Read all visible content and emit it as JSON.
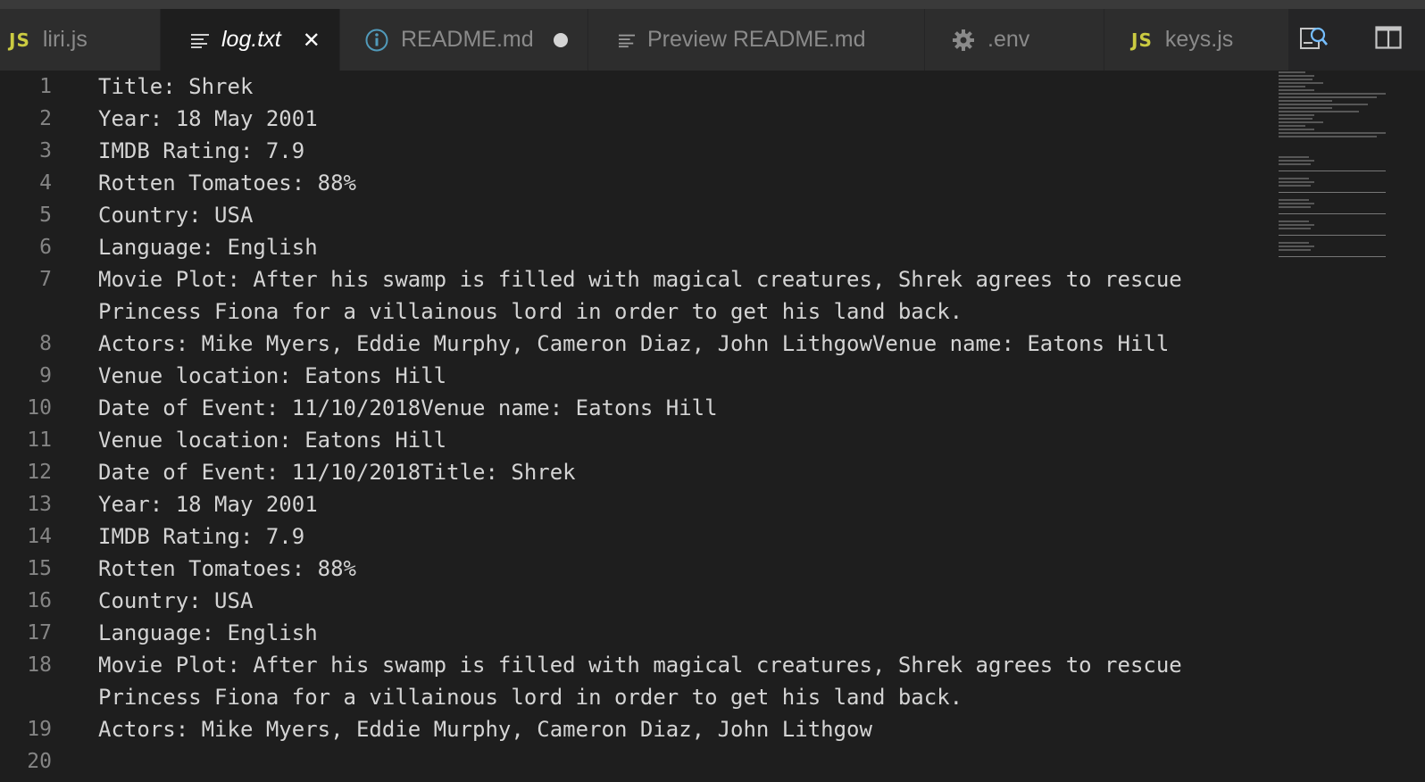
{
  "tabs": [
    {
      "label": "liri.js",
      "icon": "js-icon",
      "state": "normal"
    },
    {
      "label": "log.txt",
      "icon": "text-file-icon",
      "state": "active"
    },
    {
      "label": "README.md",
      "icon": "info-icon",
      "state": "dirty"
    },
    {
      "label": "Preview README.md",
      "icon": "text-file-icon",
      "state": "normal"
    },
    {
      "label": ".env",
      "icon": "gear-icon",
      "state": "normal"
    },
    {
      "label": "keys.js",
      "icon": "js-icon",
      "state": "normal"
    }
  ],
  "icon_text": {
    "js": "JS"
  },
  "close_glyph": "✕",
  "colors": {
    "background": "#1e1e1e",
    "tab_inactive": "#2d2d2d",
    "js_icon": "#cbcb41",
    "info_icon": "#519aba",
    "text": "#d4d4d4",
    "line_number": "#858585"
  },
  "editor": {
    "lines": [
      {
        "num": "1",
        "text": "Title: Shrek"
      },
      {
        "num": "2",
        "text": "Year: 18 May 2001"
      },
      {
        "num": "3",
        "text": "IMDB Rating: 7.9"
      },
      {
        "num": "4",
        "text": "Rotten Tomatoes: 88%"
      },
      {
        "num": "5",
        "text": "Country: USA"
      },
      {
        "num": "6",
        "text": "Language: English"
      },
      {
        "num": "7",
        "text": "Movie Plot: After his swamp is filled with magical creatures, Shrek agrees to rescue Princess Fiona for a villainous lord in order to get his land back."
      },
      {
        "num": "8",
        "text": "Actors: Mike Myers, Eddie Murphy, Cameron Diaz, John LithgowVenue name: Eatons Hill"
      },
      {
        "num": "9",
        "text": "Venue location: Eatons Hill"
      },
      {
        "num": "10",
        "text": "Date of Event: 11/10/2018Venue name: Eatons Hill"
      },
      {
        "num": "11",
        "text": "Venue location: Eatons Hill"
      },
      {
        "num": "12",
        "text": "Date of Event: 11/10/2018Title: Shrek"
      },
      {
        "num": "13",
        "text": "Year: 18 May 2001"
      },
      {
        "num": "14",
        "text": "IMDB Rating: 7.9"
      },
      {
        "num": "15",
        "text": "Rotten Tomatoes: 88%"
      },
      {
        "num": "16",
        "text": "Country: USA"
      },
      {
        "num": "17",
        "text": "Language: English"
      },
      {
        "num": "18",
        "text": "Movie Plot: After his swamp is filled with magical creatures, Shrek agrees to rescue Princess Fiona for a villainous lord in order to get his land back."
      },
      {
        "num": "19",
        "text": "Actors: Mike Myers, Eddie Murphy, Cameron Diaz, John Lithgow"
      },
      {
        "num": "20",
        "text": ""
      }
    ]
  }
}
